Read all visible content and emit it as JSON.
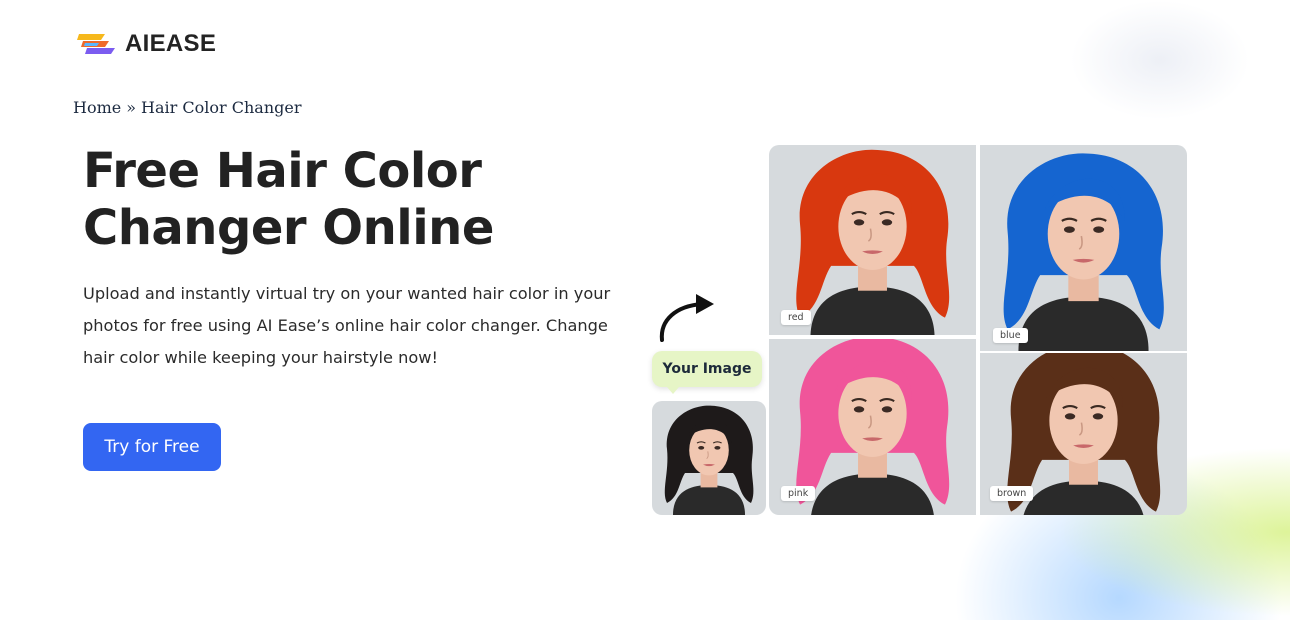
{
  "header": {
    "brand": "AIEASE"
  },
  "breadcrumb": {
    "home": "Home",
    "separator": "»",
    "current": "Hair Color Changer"
  },
  "hero": {
    "title_line1": "Free Hair Color",
    "title_line2": "Changer Online",
    "desc_line1": "Upload and instantly virtual try on your wanted hair color in your",
    "desc_line2": "photos for free using AI Ease’s online hair color changer. Change",
    "desc_line3": "hair color while keeping your hairstyle now!",
    "cta_label": "Try for Free"
  },
  "showcase": {
    "your_image_label": "Your Image",
    "samples": [
      {
        "label": "red",
        "hair_color": "#d8380f"
      },
      {
        "label": "blue",
        "hair_color": "#1565d0"
      },
      {
        "label": "pink",
        "hair_color": "#f0559a"
      },
      {
        "label": "brown",
        "hair_color": "#5a2f18"
      }
    ],
    "original_hair_color": "#1e1a1a"
  },
  "colors": {
    "accent": "#3366f2",
    "badge_bg": "#e6f5c6"
  }
}
